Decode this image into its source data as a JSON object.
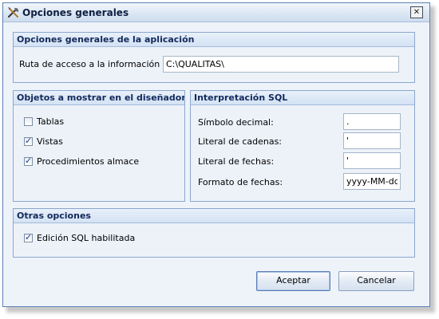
{
  "window": {
    "title": "Opciones generales",
    "close_glyph": "✕",
    "app_icon": "tools-icon"
  },
  "app_options": {
    "header": "Opciones generales de la aplicación",
    "path_label": "Ruta de acceso a la información local:",
    "path_value": "C:\\QUALITAS\\"
  },
  "designer_objects": {
    "header": "Objetos a mostrar en el diseñador vis",
    "items": [
      {
        "label": "Tablas",
        "checked": false
      },
      {
        "label": "Vistas",
        "checked": true
      },
      {
        "label": "Procedimientos almacenados",
        "checked": true
      }
    ]
  },
  "sql": {
    "header": "Interpretación SQL",
    "decimal_label": "Símbolo decimal:",
    "decimal_value": ".",
    "string_label": "Literal de cadenas:",
    "string_value": "'",
    "date_literal_label": "Literal de fechas:",
    "date_literal_value": "'",
    "date_format_label": "Formato de fechas:",
    "date_format_value": "yyyy-MM-dd"
  },
  "other": {
    "header": "Otras opciones",
    "sql_edit_label": "Edición SQL habilitada",
    "sql_edit_checked": true
  },
  "buttons": {
    "accept": "Aceptar",
    "cancel": "Cancelar"
  },
  "colors": {
    "header_text": "#12295a",
    "border": "#8ca6cc",
    "background": "#eef3fa"
  }
}
